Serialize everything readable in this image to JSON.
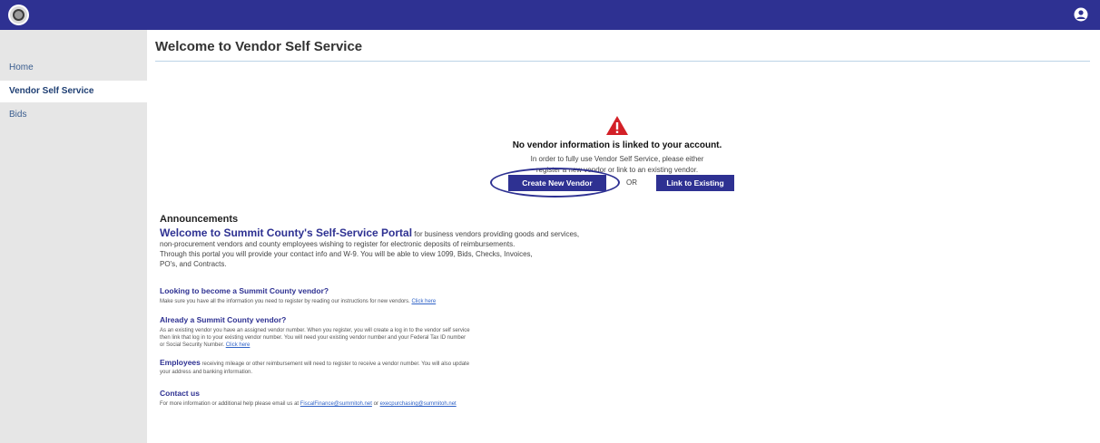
{
  "header": {
    "logo_icon": "county-seal-icon",
    "user_icon": "user-account-icon",
    "bar_color": "#2e3192"
  },
  "sidebar": {
    "items": [
      {
        "label": "Home"
      },
      {
        "label": "Vendor Self Service"
      },
      {
        "label": "Bids"
      }
    ]
  },
  "main": {
    "title": "Welcome to Vendor Self Service",
    "notice": {
      "icon": "warning-triangle-icon",
      "heading": "No vendor information is linked to your account.",
      "body_line1": "In order to fully use Vendor Self Service, please either",
      "body_line2": "register a new vendor or link to an existing vendor."
    },
    "buttons": {
      "create_label": "Create New Vendor",
      "or_text": "OR",
      "link_label": "Link to Existing"
    }
  },
  "announcements": {
    "heading": "Announcements",
    "welcome_strong": "Welcome to Summit County's Self-Service Portal",
    "welcome_rest1": " for business vendors providing goods and services,",
    "welcome_line2": "non-procurement vendors and county employees wishing to register for electronic deposits of reimbursements.",
    "welcome_line3": "Through this portal you will provide your contact info and W-9. You will be able to view 1099, Bids, Checks, Invoices,",
    "welcome_line4": "PO's, and Contracts.",
    "new_vendor_heading": "Looking to become a Summit County vendor?",
    "new_vendor_text": "Make sure you have all the information you need to register by reading our instructions for new vendors.",
    "new_vendor_link": "Click here",
    "existing_heading": "Already a Summit County vendor?",
    "existing_text1": "As an existing vendor you have an assigned vendor number. When you register, you will create a log in to the vendor self service",
    "existing_text2": "then link that log in to your existing vendor number. You will need your existing vendor number and your Federal Tax ID number",
    "existing_text3": "or Social Security Number.",
    "existing_link": "Click here",
    "employees_strong": "Employees",
    "employees_text1": " receiving mileage or other reimbursement will need to register to receive a vendor number. You will also update",
    "employees_text2": "your address and banking information.",
    "contact_heading": "Contact us",
    "contact_text": "For more information or additional help please email us at",
    "contact_email1": "FiscalFinance@summitoh.net",
    "contact_or": "or",
    "contact_email2": "execpurchasing@summitoh.net"
  }
}
